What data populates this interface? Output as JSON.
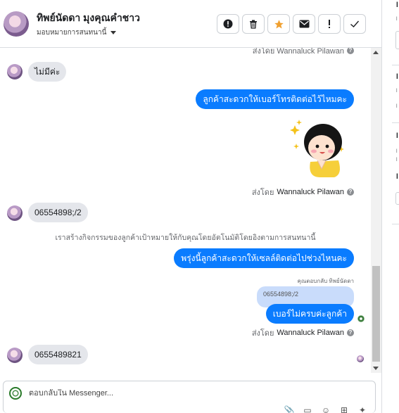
{
  "header": {
    "contact_name": "ทิพย์นัดดา มุงคุณคำชาว",
    "assign_label": "มอบหมายการสนทนานี้",
    "actions": [
      {
        "name": "spam-icon",
        "glyph": "❗"
      },
      {
        "name": "trash-icon",
        "glyph": "🗑"
      },
      {
        "name": "star-icon",
        "glyph": "★"
      },
      {
        "name": "mark-unread-icon",
        "glyph": "✉"
      },
      {
        "name": "follow-up-icon",
        "glyph": "!"
      },
      {
        "name": "done-icon",
        "glyph": "✓"
      }
    ]
  },
  "messages": {
    "sent_by_prefix": "ส่งโดย",
    "sender_name": "Wannaluck Pilawan",
    "top_sentby": "ส่งโดย Wannaluck Pilawan",
    "msg1_in": "ไม่มีค่ะ",
    "msg2_out": "ลูกค้าสะดวกให้เบอร์โทรติดต่อไว้ไหมคะ",
    "msg4_in": "06554898;/2",
    "system_note": "เราสร้างกิจกรรมของลูกค้าเป้าหมายให้กับคุณโดยอัตโนมัติโดยอิงตามการสนทนานี้",
    "msg5_out": "พรุ่งนี้ลูกค้าสะดวกให้เซลล์ติดต่อไปช่วงไหนคะ",
    "reply_label": "คุณตอบกลับ ทิพย์นัดดา",
    "quoted_text": "06554898;/2",
    "msg6_out": "เบอร์ไม่ครบค่ะลูกค้า",
    "msg7_in": "0655489821"
  },
  "composer": {
    "placeholder": "ตอบกลับใน Messenger..."
  },
  "colors": {
    "outgoing_bubble": "#0a7cff",
    "incoming_bubble": "#e4e6eb",
    "star_accent": "#f0a030"
  }
}
